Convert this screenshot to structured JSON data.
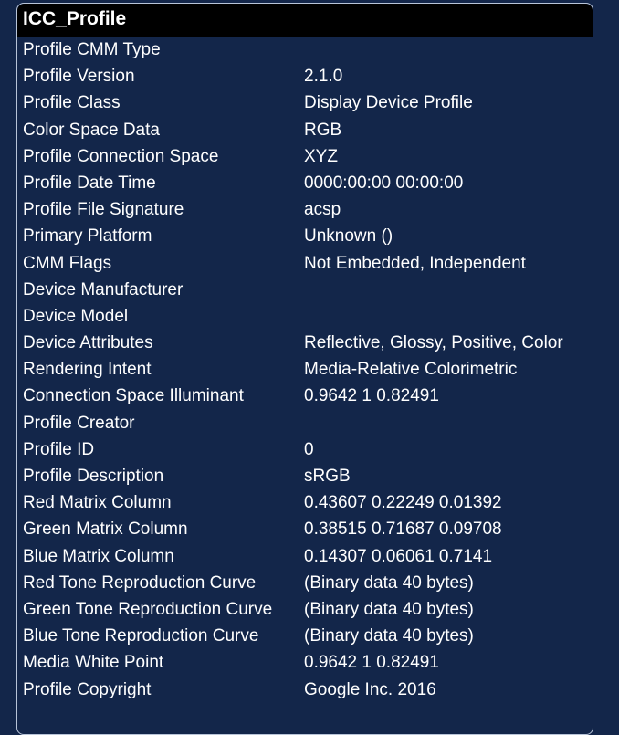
{
  "section": {
    "title": "ICC_Profile"
  },
  "rows": [
    {
      "key": "Profile CMM Type",
      "value": ""
    },
    {
      "key": "Profile Version",
      "value": "2.1.0"
    },
    {
      "key": "Profile Class",
      "value": "Display Device Profile"
    },
    {
      "key": "Color Space Data",
      "value": "RGB"
    },
    {
      "key": "Profile Connection Space",
      "value": "XYZ"
    },
    {
      "key": "Profile Date Time",
      "value": "0000:00:00 00:00:00"
    },
    {
      "key": "Profile File Signature",
      "value": "acsp"
    },
    {
      "key": "Primary Platform",
      "value": "Unknown ()"
    },
    {
      "key": "CMM Flags",
      "value": "Not Embedded, Independent"
    },
    {
      "key": "Device Manufacturer",
      "value": ""
    },
    {
      "key": "Device Model",
      "value": ""
    },
    {
      "key": "Device Attributes",
      "value": "Reflective, Glossy, Positive, Color"
    },
    {
      "key": "Rendering Intent",
      "value": "Media-Relative Colorimetric"
    },
    {
      "key": "Connection Space Illuminant",
      "value": "0.9642 1 0.82491"
    },
    {
      "key": "Profile Creator",
      "value": ""
    },
    {
      "key": "Profile ID",
      "value": "0"
    },
    {
      "key": "Profile Description",
      "value": "sRGB"
    },
    {
      "key": "Red Matrix Column",
      "value": "0.43607 0.22249 0.01392"
    },
    {
      "key": "Green Matrix Column",
      "value": "0.38515 0.71687 0.09708"
    },
    {
      "key": "Blue Matrix Column",
      "value": "0.14307 0.06061 0.7141"
    },
    {
      "key": "Red Tone Reproduction Curve",
      "value": "(Binary data 40 bytes)"
    },
    {
      "key": "Green Tone Reproduction Curve",
      "value": "(Binary data 40 bytes)"
    },
    {
      "key": "Blue Tone Reproduction Curve",
      "value": "(Binary data 40 bytes)"
    },
    {
      "key": "Media White Point",
      "value": "0.9642 1 0.82491"
    },
    {
      "key": "Profile Copyright",
      "value": "Google Inc. 2016"
    }
  ]
}
